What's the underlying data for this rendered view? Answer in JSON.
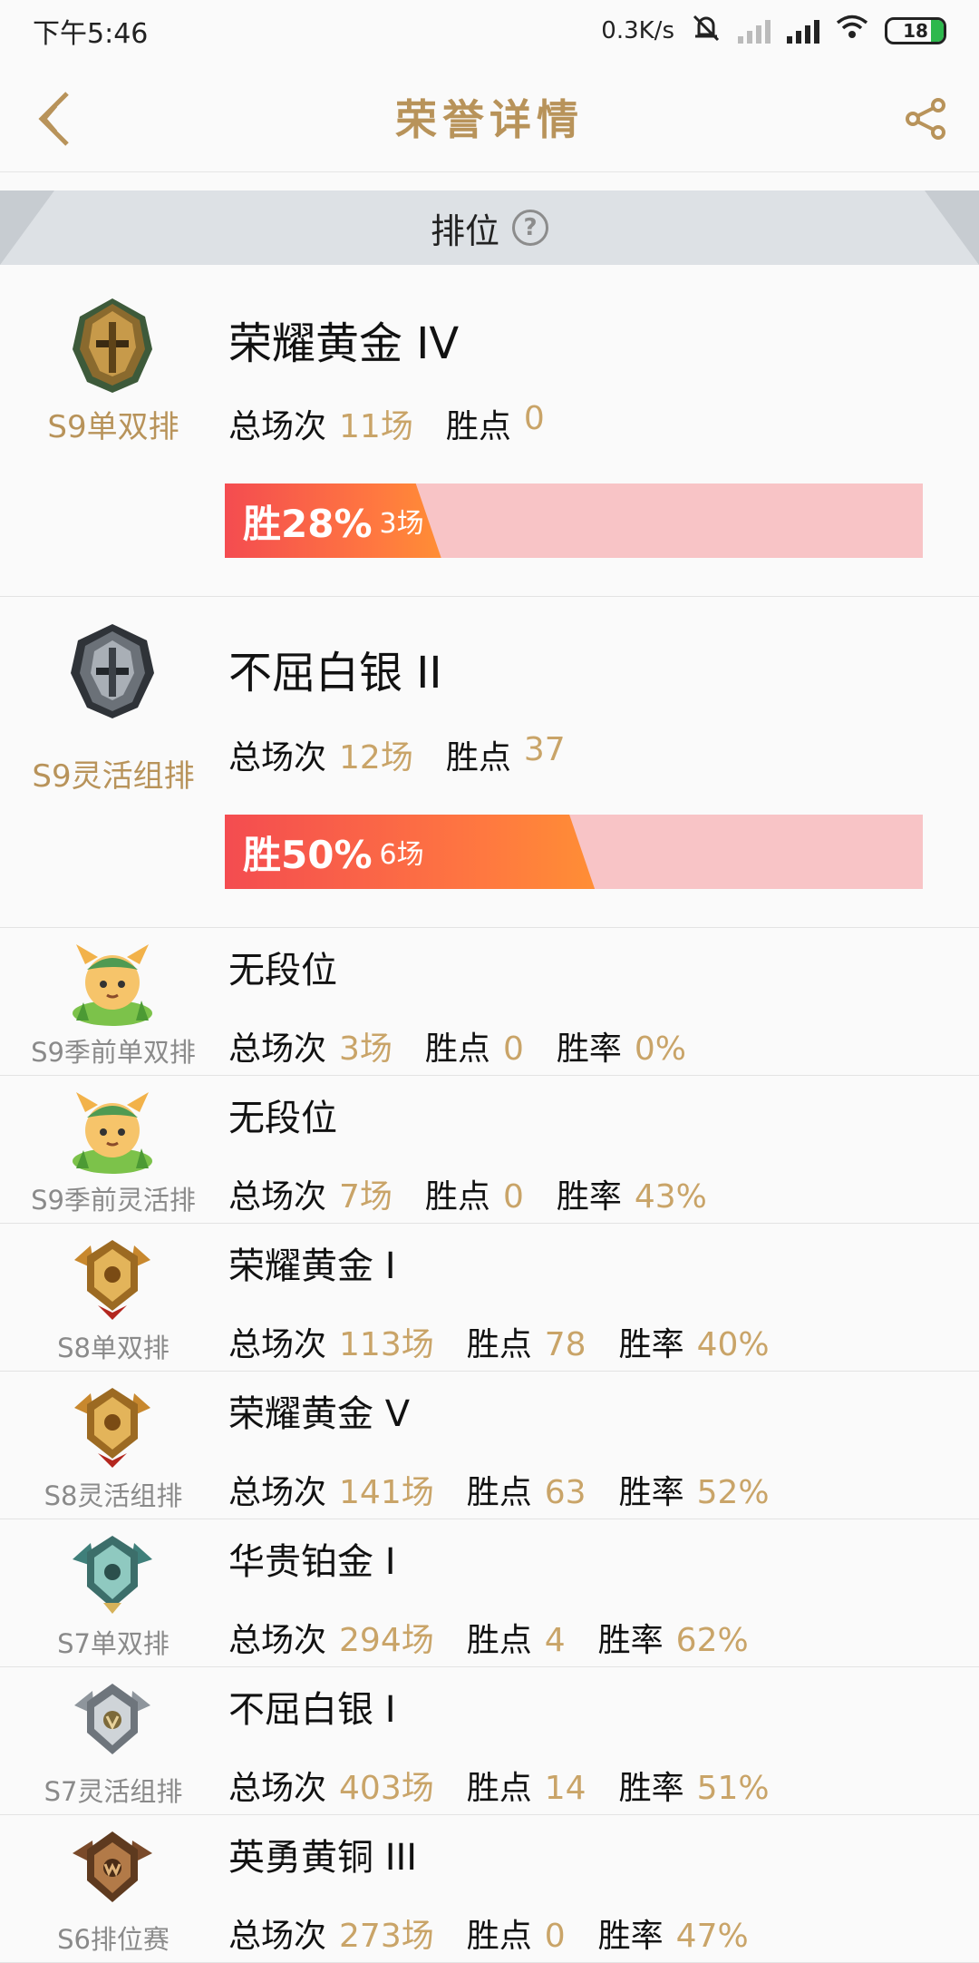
{
  "status_bar": {
    "time": "下午5:46",
    "net_speed": "0.3K/s",
    "battery": "18"
  },
  "header": {
    "title": "荣誉详情"
  },
  "section": {
    "label": "排位"
  },
  "labels": {
    "total": "总场次",
    "points": "胜点",
    "rate": "胜率",
    "win": "胜"
  },
  "featured": [
    {
      "queue": "S9单双排",
      "tier": "荣耀黄金 IV",
      "games": "11场",
      "points": "0",
      "win_pct": "28%",
      "win_games": "3场",
      "win_rate": 0.28,
      "emblem_color": "#8a6a2e"
    },
    {
      "queue": "S9灵活组排",
      "tier": "不屈白银 II",
      "games": "12场",
      "points": "37",
      "win_pct": "50%",
      "win_games": "6场",
      "win_rate": 0.5,
      "emblem_color": "#5a5f66"
    }
  ],
  "history": [
    {
      "queue": "S9季前单双排",
      "tier": "无段位",
      "games": "3场",
      "points": "0",
      "rate": "0%",
      "emblem": "teemo-icon"
    },
    {
      "queue": "S9季前灵活排",
      "tier": "无段位",
      "games": "7场",
      "points": "0",
      "rate": "43%",
      "emblem": "teemo-icon"
    },
    {
      "queue": "S8单双排",
      "tier": "荣耀黄金 I",
      "games": "113场",
      "points": "78",
      "rate": "40%",
      "emblem": "gold-emblem-icon"
    },
    {
      "queue": "S8灵活组排",
      "tier": "荣耀黄金 V",
      "games": "141场",
      "points": "63",
      "rate": "52%",
      "emblem": "gold-emblem-icon"
    },
    {
      "queue": "S7单双排",
      "tier": "华贵铂金 I",
      "games": "294场",
      "points": "4",
      "rate": "62%",
      "emblem": "platinum-emblem-icon"
    },
    {
      "queue": "S7灵活组排",
      "tier": "不屈白银 I",
      "games": "403场",
      "points": "14",
      "rate": "51%",
      "emblem": "silver-emblem-icon"
    },
    {
      "queue": "S6排位赛",
      "tier": "英勇黄铜 III",
      "games": "273场",
      "points": "0",
      "rate": "47%",
      "emblem": "bronze-emblem-icon"
    }
  ],
  "colors": {
    "accent_gold": "#b8935a",
    "value_gold": "#c9a468",
    "bar_track": "#f8c4c6",
    "bar_fill_start": "#f44c50",
    "bar_fill_end": "#ff8e35"
  }
}
